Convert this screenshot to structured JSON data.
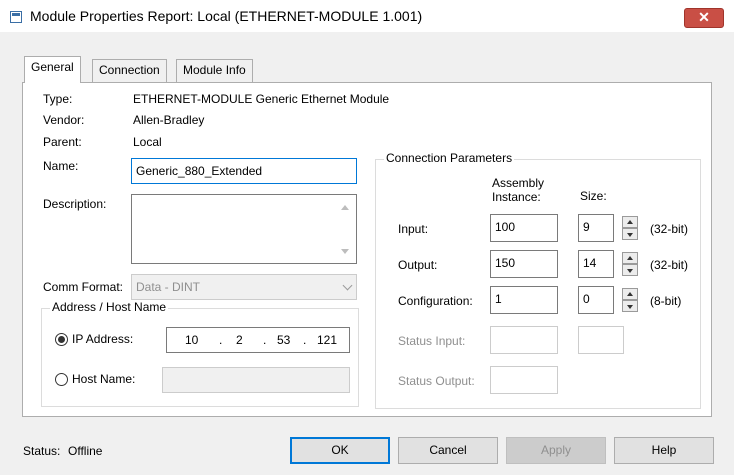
{
  "window": {
    "title": "Module Properties Report: Local (ETHERNET-MODULE 1.001)",
    "close_glyph": "✕"
  },
  "tabs": [
    {
      "label": "General",
      "active": true
    },
    {
      "label": "Connection",
      "active": false
    },
    {
      "label": "Module Info",
      "active": false
    }
  ],
  "general": {
    "type_label": "Type:",
    "type_value": "ETHERNET-MODULE Generic Ethernet Module",
    "vendor_label": "Vendor:",
    "vendor_value": "Allen-Bradley",
    "parent_label": "Parent:",
    "parent_value": "Local",
    "name_label": "Name:",
    "name_value": "Generic_880_Extended",
    "description_label": "Description:",
    "description_value": "",
    "comm_format_label": "Comm Format:",
    "comm_format_value": "Data - DINT"
  },
  "address": {
    "group_title": "Address / Host Name",
    "ip_label": "IP Address:",
    "ip_octets": [
      "10",
      "2",
      "53",
      "121"
    ],
    "host_label": "Host Name:",
    "host_value": "",
    "selected": "ip"
  },
  "connection": {
    "group_title": "Connection Parameters",
    "assembly_header_line1": "Assembly",
    "assembly_header_line2": "Instance:",
    "size_header": "Size:",
    "rows": [
      {
        "label": "Input:",
        "instance": "100",
        "size": "9",
        "unit": "(32-bit)",
        "enabled": true
      },
      {
        "label": "Output:",
        "instance": "150",
        "size": "14",
        "unit": "(32-bit)",
        "enabled": true
      },
      {
        "label": "Configuration:",
        "instance": "1",
        "size": "0",
        "unit": "(8-bit)",
        "enabled": true
      },
      {
        "label": "Status Input:",
        "instance": "",
        "size": "",
        "unit": "",
        "enabled": false
      },
      {
        "label": "Status Output:",
        "instance": "",
        "size": "",
        "unit": "",
        "enabled": false
      }
    ]
  },
  "footer": {
    "status_label": "Status:",
    "status_value": "Offline",
    "ok_label": "OK",
    "cancel_label": "Cancel",
    "apply_label": "Apply",
    "help_label": "Help"
  },
  "colors": {
    "close_button": "#c94f45",
    "focus_border": "#0078d7",
    "disabled_text": "#8f8f8f"
  }
}
